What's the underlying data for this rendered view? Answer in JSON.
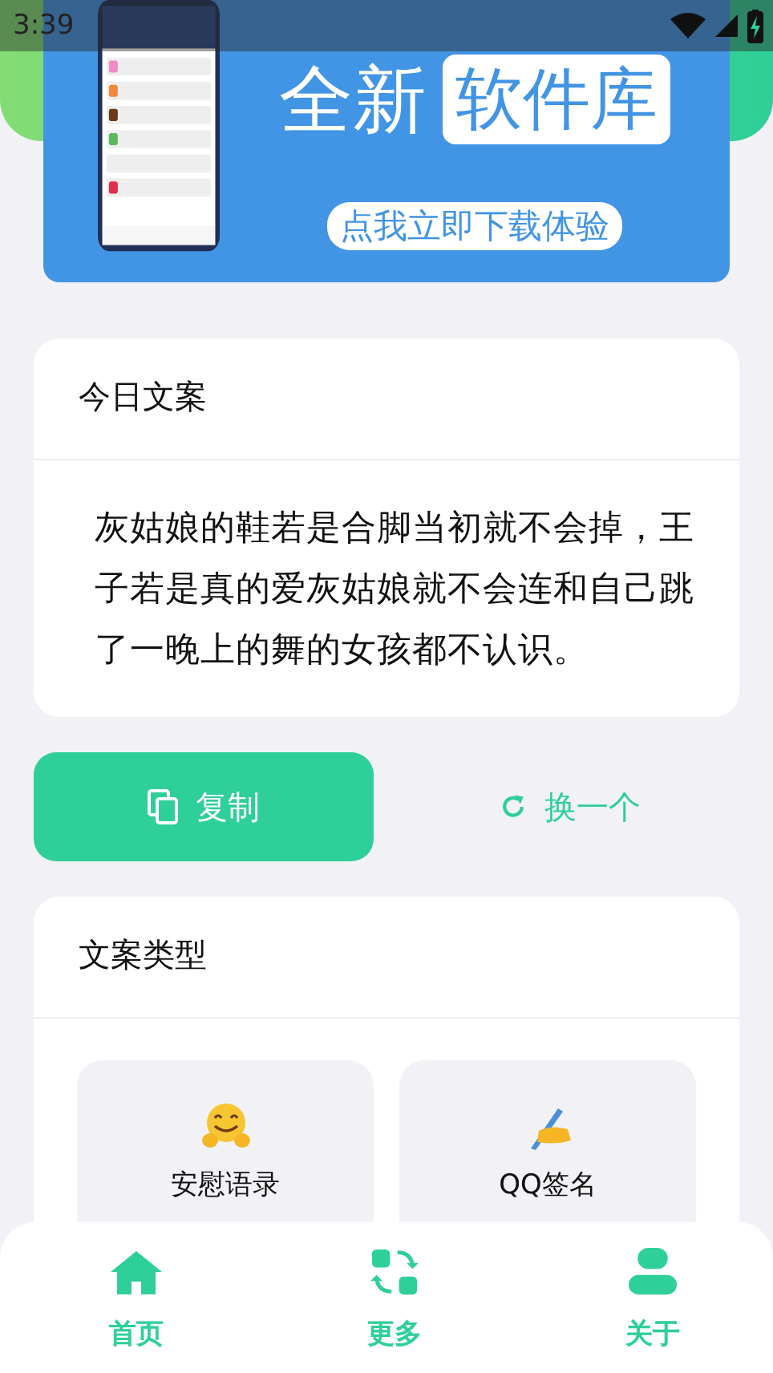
{
  "status_bar": {
    "time": "3:39"
  },
  "banner": {
    "headline": "全新",
    "highlight": "软件库",
    "cta": "点我立即下载体验"
  },
  "daily_copy": {
    "title": "今日文案",
    "text": "灰姑娘的鞋若是合脚当初就不会掉，王子若是真的爱灰姑娘就不会连和自己跳了一晚上的舞的女孩都不认识。"
  },
  "actions": [
    {
      "kind": "copy",
      "label": "复制"
    },
    {
      "kind": "refresh",
      "label": "换一个"
    }
  ],
  "categories": {
    "title": "文案类型",
    "items": [
      {
        "kind": "hug",
        "label": "安慰语录"
      },
      {
        "kind": "write",
        "label": "QQ签名"
      }
    ]
  },
  "bottom_nav": [
    {
      "kind": "home",
      "label": "首页"
    },
    {
      "kind": "more",
      "label": "更多"
    },
    {
      "kind": "about",
      "label": "关于"
    }
  ]
}
